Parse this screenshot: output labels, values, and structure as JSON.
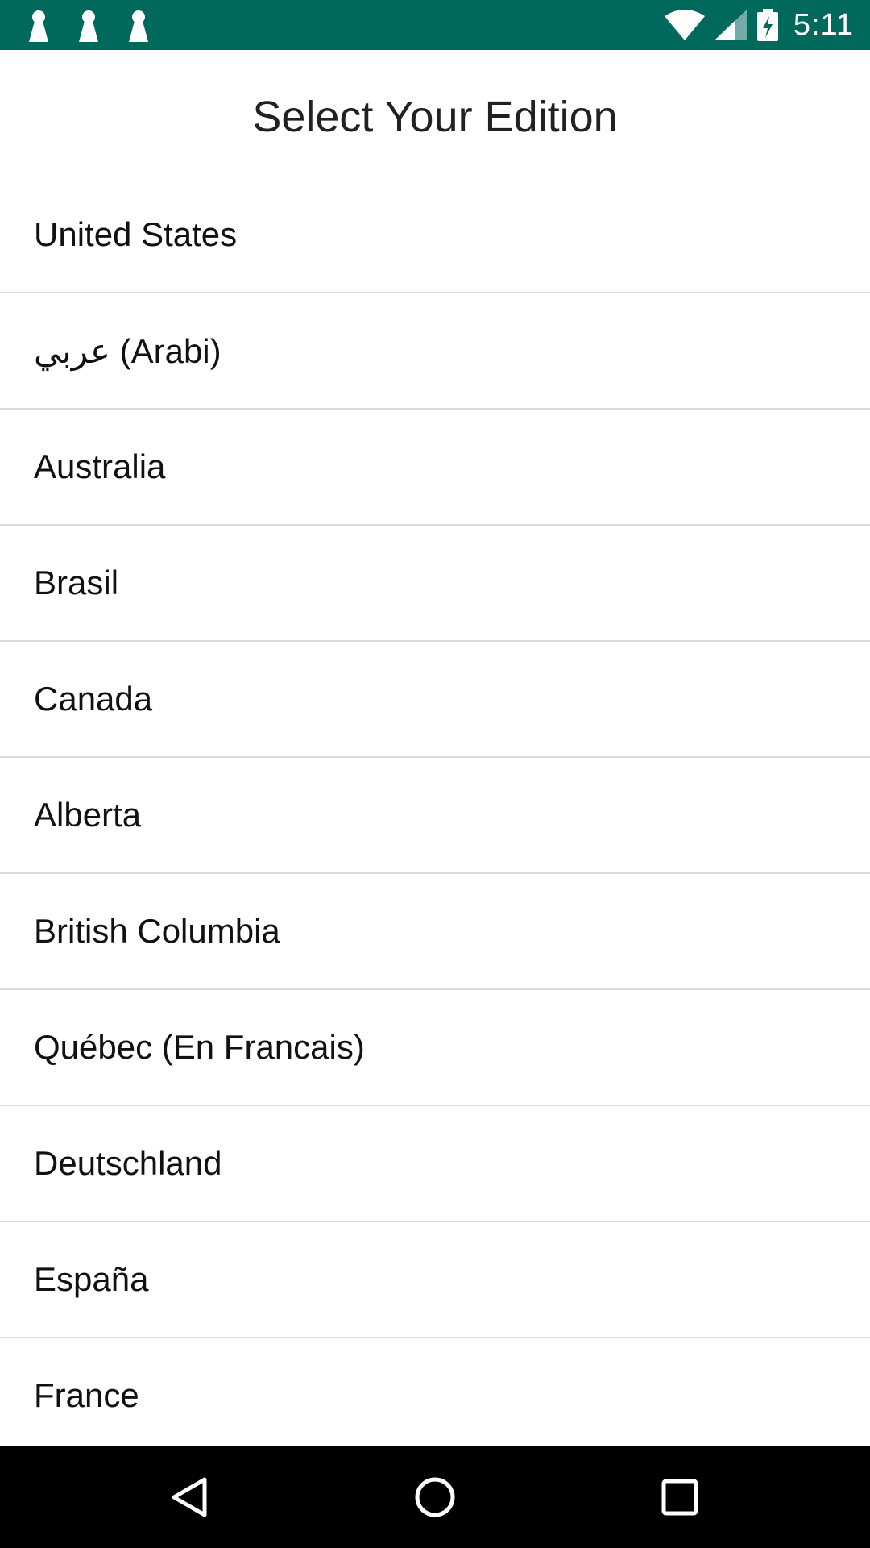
{
  "status_bar": {
    "time": "5:11",
    "background_color": "#00695c",
    "notification_icons": [
      "notification-icon",
      "notification-icon",
      "notification-icon"
    ],
    "indicator_icons": [
      "wifi-icon",
      "cellular-signal-icon",
      "battery-charging-icon"
    ]
  },
  "page": {
    "title": "Select Your Edition"
  },
  "editions": [
    "United States",
    "عربي (Arabi)",
    "Australia",
    "Brasil",
    "Canada",
    "Alberta",
    "British Columbia",
    "Québec (En Francais)",
    "Deutschland",
    "España",
    "France"
  ],
  "nav_bar": {
    "icons": [
      "back-icon",
      "home-icon",
      "recents-icon"
    ]
  }
}
